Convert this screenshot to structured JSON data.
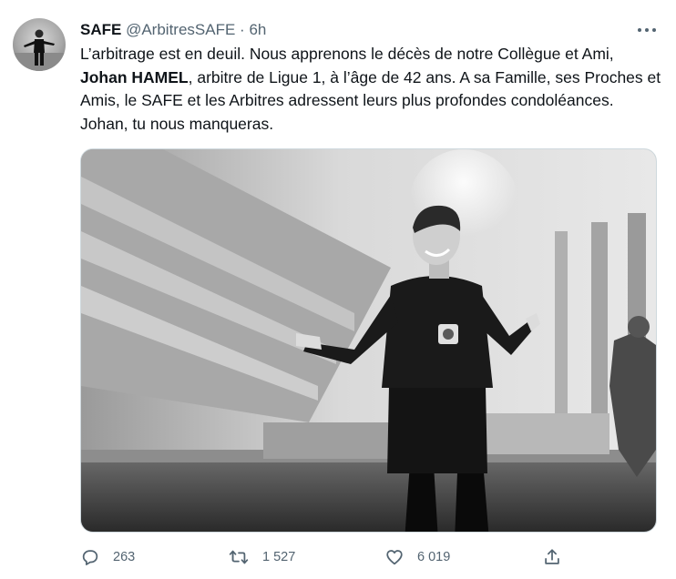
{
  "tweet": {
    "author_name": "SAFE",
    "author_handle": "@ArbitresSAFE",
    "separator": "·",
    "time": "6h",
    "text_part1": "L’arbitrage est en deuil. Nous apprenons le décès de notre Collègue et Ami, ",
    "text_bold": "Johan HAMEL",
    "text_part2": ", arbitre de Ligue 1, à l’âge de 42 ans. A sa Famille, ses Proches et Amis, le SAFE et les Arbitres adressent leurs plus profondes condoléances. Johan, tu nous manqueras."
  },
  "actions": {
    "replies": "263",
    "retweets": "1 527",
    "likes": "6 019"
  },
  "icons": {
    "more": "more-horizontal-icon",
    "reply": "reply-bubble-icon",
    "retweet": "retweet-icon",
    "like": "heart-icon",
    "share": "share-upload-icon"
  },
  "colors": {
    "text_primary": "#0f1419",
    "text_secondary": "#536471",
    "border": "#cfd9de"
  }
}
